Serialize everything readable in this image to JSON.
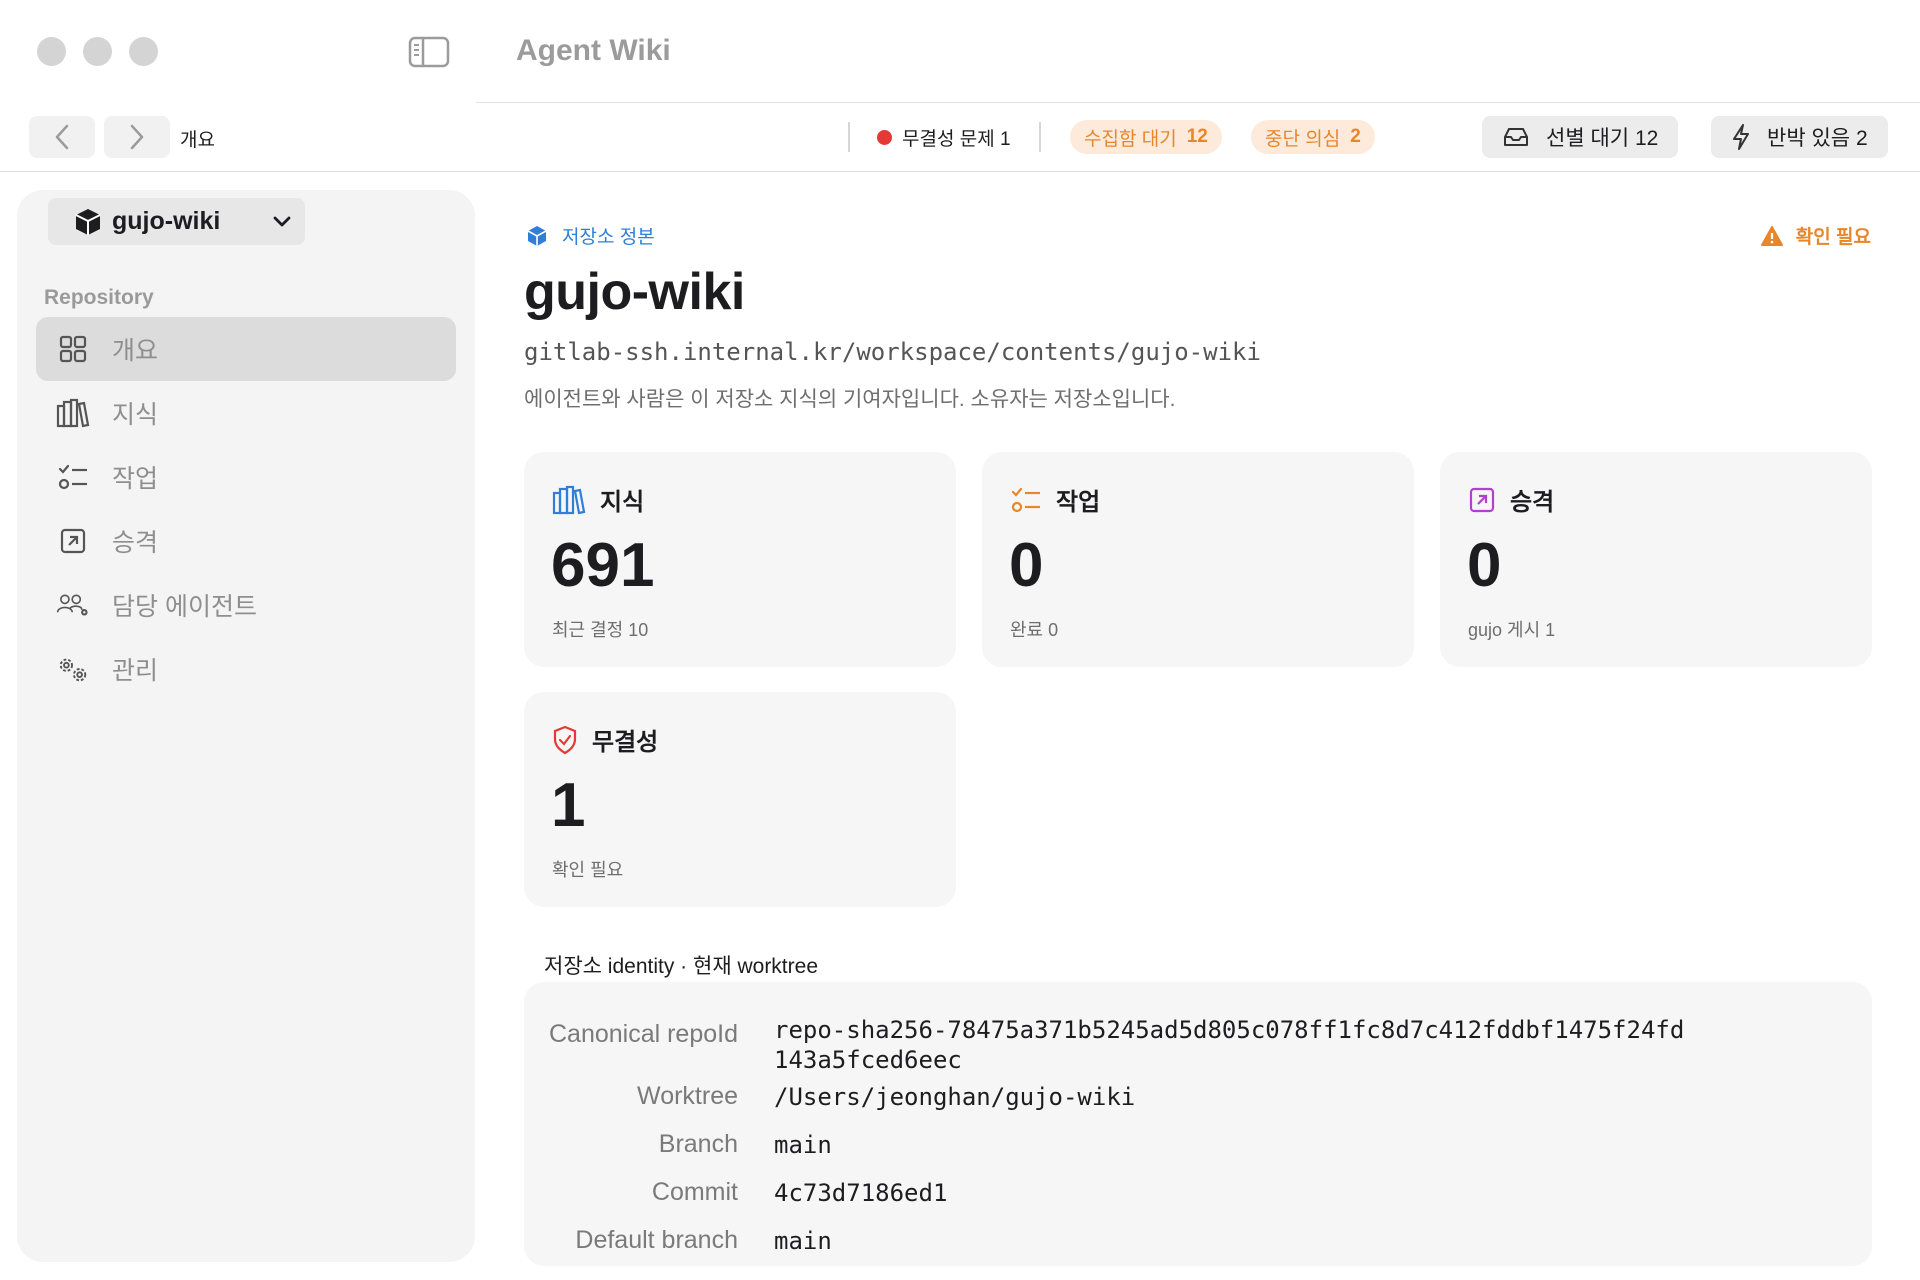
{
  "app": {
    "title": "Agent Wiki"
  },
  "toolbar": {
    "breadcrumb": "개요",
    "integrity_issue": "무결성 문제 1",
    "collect_pending_label": "수집함 대기",
    "collect_pending_count": "12",
    "suspend_suspect_label": "중단 의심",
    "suspend_suspect_count": "2",
    "triage_pending": "선별 대기 12",
    "rebuttal": "반박 있음 2",
    "colors": {
      "issue_dot": "#e53935",
      "pill_text": "#e8862a",
      "pill_bg": "#fdeadb"
    }
  },
  "sidebar": {
    "repo_name": "gujo-wiki",
    "section": "Repository",
    "items": [
      {
        "label": "개요",
        "icon": "grid-icon",
        "active": true
      },
      {
        "label": "지식",
        "icon": "books-icon",
        "active": false
      },
      {
        "label": "작업",
        "icon": "checklist-icon",
        "active": false
      },
      {
        "label": "승격",
        "icon": "arrow-up-right-icon",
        "active": false
      },
      {
        "label": "담당 에이전트",
        "icon": "people-gear-icon",
        "active": false
      },
      {
        "label": "관리",
        "icon": "gears-icon",
        "active": false
      }
    ]
  },
  "main": {
    "origin_label": "저장소 정본",
    "warning": "확인 필요",
    "title": "gujo-wiki",
    "url": "gitlab-ssh.internal.kr/workspace/contents/gujo-wiki",
    "description": "에이전트와 사람은 이 저장소 지식의 기여자입니다. 소유자는 저장소입니다.",
    "cards": [
      {
        "title": "지식",
        "value": "691",
        "sub": "최근 결정 10",
        "icon": "books-icon",
        "color": "#2f7ed8"
      },
      {
        "title": "작업",
        "value": "0",
        "sub": "완료 0",
        "icon": "checklist-icon",
        "color": "#e8862a"
      },
      {
        "title": "승격",
        "value": "0",
        "sub": "gujo 게시 1",
        "icon": "arrow-up-right-icon",
        "color": "#b23fd0"
      },
      {
        "title": "무결성",
        "value": "1",
        "sub": "확인 필요",
        "icon": "shield-icon",
        "color": "#e53935"
      }
    ],
    "identity": {
      "label": "저장소 identity · 현재 worktree",
      "rows": [
        {
          "key": "Canonical repoId",
          "value": "repo-sha256-78475a371b5245ad5d805c078ff1fc8d7c412fddbf1475f24fd",
          "value2": "143a5fced6eec"
        },
        {
          "key": "Worktree",
          "value": "/Users/jeonghan/gujo-wiki"
        },
        {
          "key": "Branch",
          "value": "main"
        },
        {
          "key": "Commit",
          "value": "4c73d7186ed1"
        },
        {
          "key": "Default branch",
          "value": "main"
        }
      ]
    }
  }
}
